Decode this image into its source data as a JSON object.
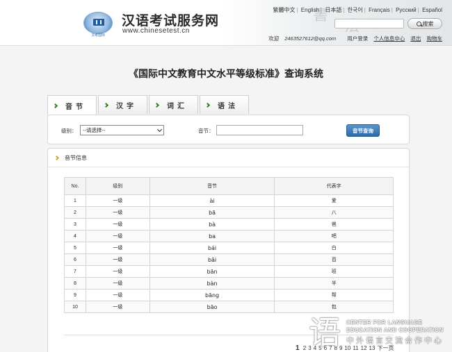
{
  "header": {
    "logo_caption": "汉考国际",
    "site_title": "汉语考试服务网",
    "site_url": "www.chinesetest.cn",
    "languages": [
      "繁體中文",
      "English",
      "日本語",
      "한국어",
      "Français",
      "Русский",
      "Español"
    ],
    "search_button": "搜索",
    "welcome": "欢迎",
    "email": "2463527612@qq.com",
    "user_login": "用户登录",
    "personal_center": "个人信息中心",
    "logout": "退出",
    "cart": "购物车"
  },
  "page_title": "《国际中文教育中文水平等级标准》查询系统",
  "tabs": [
    "音节",
    "汉字",
    "词汇",
    "语法"
  ],
  "query": {
    "level_label": "级别：",
    "level_selected": "--请选择--",
    "syllable_label": "音节：",
    "syllable_value": "",
    "submit_label": "音节查询"
  },
  "results": {
    "heading": "音节信息",
    "columns": [
      "No.",
      "级别",
      "音节",
      "代表字"
    ],
    "rows": [
      [
        "1",
        "一级",
        "ài",
        "爱"
      ],
      [
        "2",
        "一级",
        "bā",
        "八"
      ],
      [
        "3",
        "一级",
        "bà",
        "爸"
      ],
      [
        "4",
        "一级",
        "ba",
        "吧"
      ],
      [
        "5",
        "一级",
        "bái",
        "白"
      ],
      [
        "6",
        "一级",
        "bǎi",
        "百"
      ],
      [
        "7",
        "一级",
        "bān",
        "班"
      ],
      [
        "8",
        "一级",
        "bàn",
        "半"
      ],
      [
        "9",
        "一级",
        "bāng",
        "帮"
      ],
      [
        "10",
        "一级",
        "bāo",
        "包"
      ]
    ]
  },
  "pagination": {
    "current": "1",
    "pages": [
      "2",
      "3",
      "4",
      "5",
      "6",
      "7",
      "8",
      "9",
      "10",
      "11",
      "12",
      "13"
    ],
    "next_label": "下一页"
  },
  "watermark": {
    "english_1": "CENTER FOR LANGUAGE",
    "english_2": "EDUCATION AND COOPERATION",
    "chinese": "中外语言交流合作中心"
  }
}
